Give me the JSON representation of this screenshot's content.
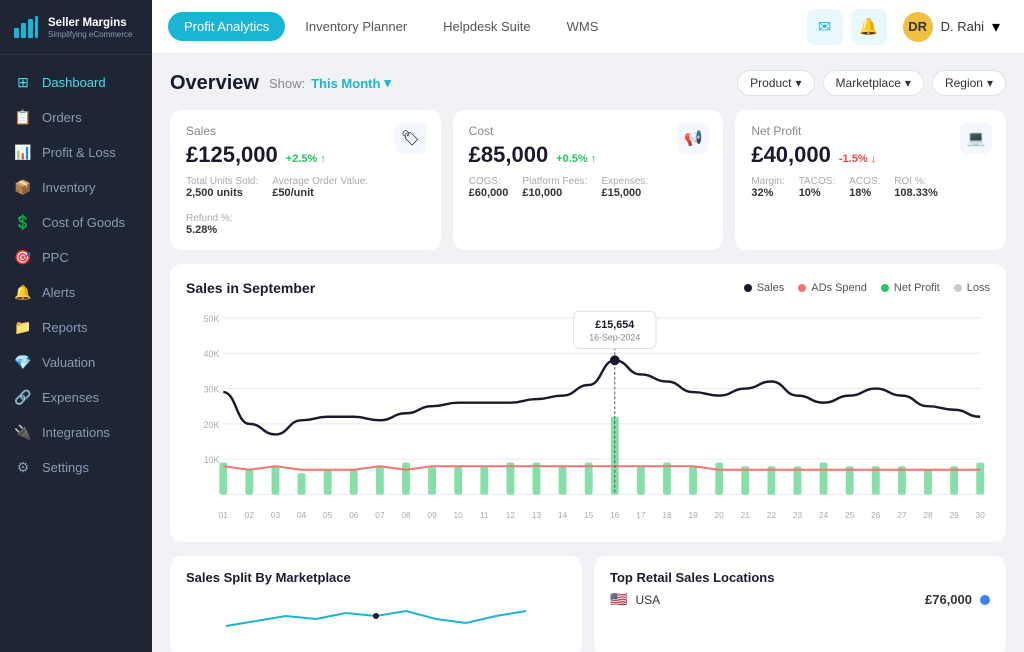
{
  "sidebar": {
    "logo": {
      "name": "Seller Margins",
      "sub": "Simplifying eCommerce"
    },
    "items": [
      {
        "id": "dashboard",
        "label": "Dashboard",
        "icon": "⊞",
        "active": true
      },
      {
        "id": "orders",
        "label": "Orders",
        "icon": "📋",
        "active": false
      },
      {
        "id": "profit-loss",
        "label": "Profit & Loss",
        "icon": "📊",
        "active": false
      },
      {
        "id": "inventory",
        "label": "Inventory",
        "icon": "📦",
        "active": false
      },
      {
        "id": "cost-of-goods",
        "label": "Cost of Goods",
        "icon": "💲",
        "active": false
      },
      {
        "id": "ppc",
        "label": "PPC",
        "icon": "🎯",
        "active": false
      },
      {
        "id": "alerts",
        "label": "Alerts",
        "icon": "🔔",
        "active": false
      },
      {
        "id": "reports",
        "label": "Reports",
        "icon": "📁",
        "active": false
      },
      {
        "id": "valuation",
        "label": "Valuation",
        "icon": "💎",
        "active": false
      },
      {
        "id": "expenses",
        "label": "Expenses",
        "icon": "🔗",
        "active": false
      },
      {
        "id": "integrations",
        "label": "Integrations",
        "icon": "🔌",
        "active": false
      },
      {
        "id": "settings",
        "label": "Settings",
        "icon": "⚙",
        "active": false
      }
    ]
  },
  "topbar": {
    "tabs": [
      {
        "id": "profit-analytics",
        "label": "Profit Analytics",
        "active": true
      },
      {
        "id": "inventory-planner",
        "label": "Inventory Planner",
        "active": false
      },
      {
        "id": "helpdesk-suite",
        "label": "Helpdesk Suite",
        "active": false
      },
      {
        "id": "wms",
        "label": "WMS",
        "active": false
      }
    ],
    "user": {
      "name": "D. Rahi",
      "initials": "DR"
    }
  },
  "overview": {
    "title": "Overview",
    "show_label": "Show:",
    "period": "This Month",
    "filters": [
      {
        "id": "product",
        "label": "Product"
      },
      {
        "id": "marketplace",
        "label": "Marketplace"
      },
      {
        "id": "region",
        "label": "Region"
      }
    ]
  },
  "metrics": {
    "sales": {
      "title": "Sales",
      "value": "£125,000",
      "change": "+2.5% ↑",
      "change_type": "up",
      "icon": "🏷",
      "sub": [
        {
          "label": "Total Units Sold:",
          "value": "2,500 units"
        },
        {
          "label": "Average Order Value:",
          "value": "£50/unit"
        },
        {
          "label": "Refund %:",
          "value": "5.28%"
        }
      ]
    },
    "cost": {
      "title": "Cost",
      "value": "£85,000",
      "change": "+0.5% ↑",
      "change_type": "up",
      "icon": "📢",
      "sub": [
        {
          "label": "COGS:",
          "value": "£60,000"
        },
        {
          "label": "Platform Fees:",
          "value": "£10,000"
        },
        {
          "label": "Expenses:",
          "value": "£15,000"
        }
      ]
    },
    "net_profit": {
      "title": "Net Profit",
      "value": "£40,000",
      "change": "-1.5% ↓",
      "change_type": "down",
      "icon": "💻",
      "sub": [
        {
          "label": "Margin:",
          "value": "32%"
        },
        {
          "label": "TACOS:",
          "value": "10%"
        },
        {
          "label": "ACOS:",
          "value": "18%"
        },
        {
          "label": "ROI %:",
          "value": "108.33%"
        }
      ]
    }
  },
  "chart": {
    "title": "Sales in September",
    "tooltip": {
      "value": "£15,654",
      "date": "16-Sep-2024"
    },
    "legend": [
      {
        "id": "sales",
        "label": "Sales",
        "color": "#1a1a2e"
      },
      {
        "id": "ads-spend",
        "label": "ADs Spend",
        "color": "#f87171"
      },
      {
        "id": "net-profit",
        "label": "Net Profit",
        "color": "#22c55e"
      },
      {
        "id": "loss",
        "label": "Loss",
        "color": "#ccc"
      }
    ],
    "x_labels": [
      "01",
      "02",
      "03",
      "04",
      "05",
      "06",
      "07",
      "08",
      "09",
      "10",
      "11",
      "12",
      "13",
      "14",
      "15",
      "16",
      "17",
      "18",
      "19",
      "20",
      "21",
      "22",
      "23",
      "24",
      "25",
      "26",
      "27",
      "28",
      "29",
      "30"
    ],
    "y_labels": [
      "50K",
      "40K",
      "30K",
      "20K",
      "10K",
      ""
    ],
    "sales_line": [
      29,
      20,
      17,
      21,
      22,
      22,
      21,
      23,
      25,
      26,
      26,
      26,
      27,
      28,
      31,
      38,
      34,
      32,
      29,
      28,
      30,
      32,
      28,
      26,
      28,
      30,
      28,
      25,
      24,
      22
    ],
    "ads_line": [
      8,
      7,
      8,
      7,
      7,
      7,
      8,
      7,
      8,
      8,
      8,
      8,
      8,
      8,
      8,
      8,
      8,
      8,
      8,
      7,
      7,
      7,
      7,
      7,
      7,
      7,
      7,
      7,
      7,
      7
    ],
    "bars": [
      9,
      7,
      8,
      6,
      7,
      7,
      8,
      9,
      8,
      8,
      8,
      9,
      9,
      8,
      9,
      22,
      8,
      9,
      8,
      9,
      8,
      8,
      8,
      9,
      8,
      8,
      8,
      7,
      8,
      9
    ]
  },
  "bottom": {
    "sales_split": {
      "title": "Sales Split By Marketplace"
    },
    "top_retail": {
      "title": "Top Retail Sales Locations",
      "items": [
        {
          "country": "USA",
          "flag": "🇺🇸",
          "amount": "£76,000",
          "color": "#3b82f6"
        }
      ]
    }
  }
}
